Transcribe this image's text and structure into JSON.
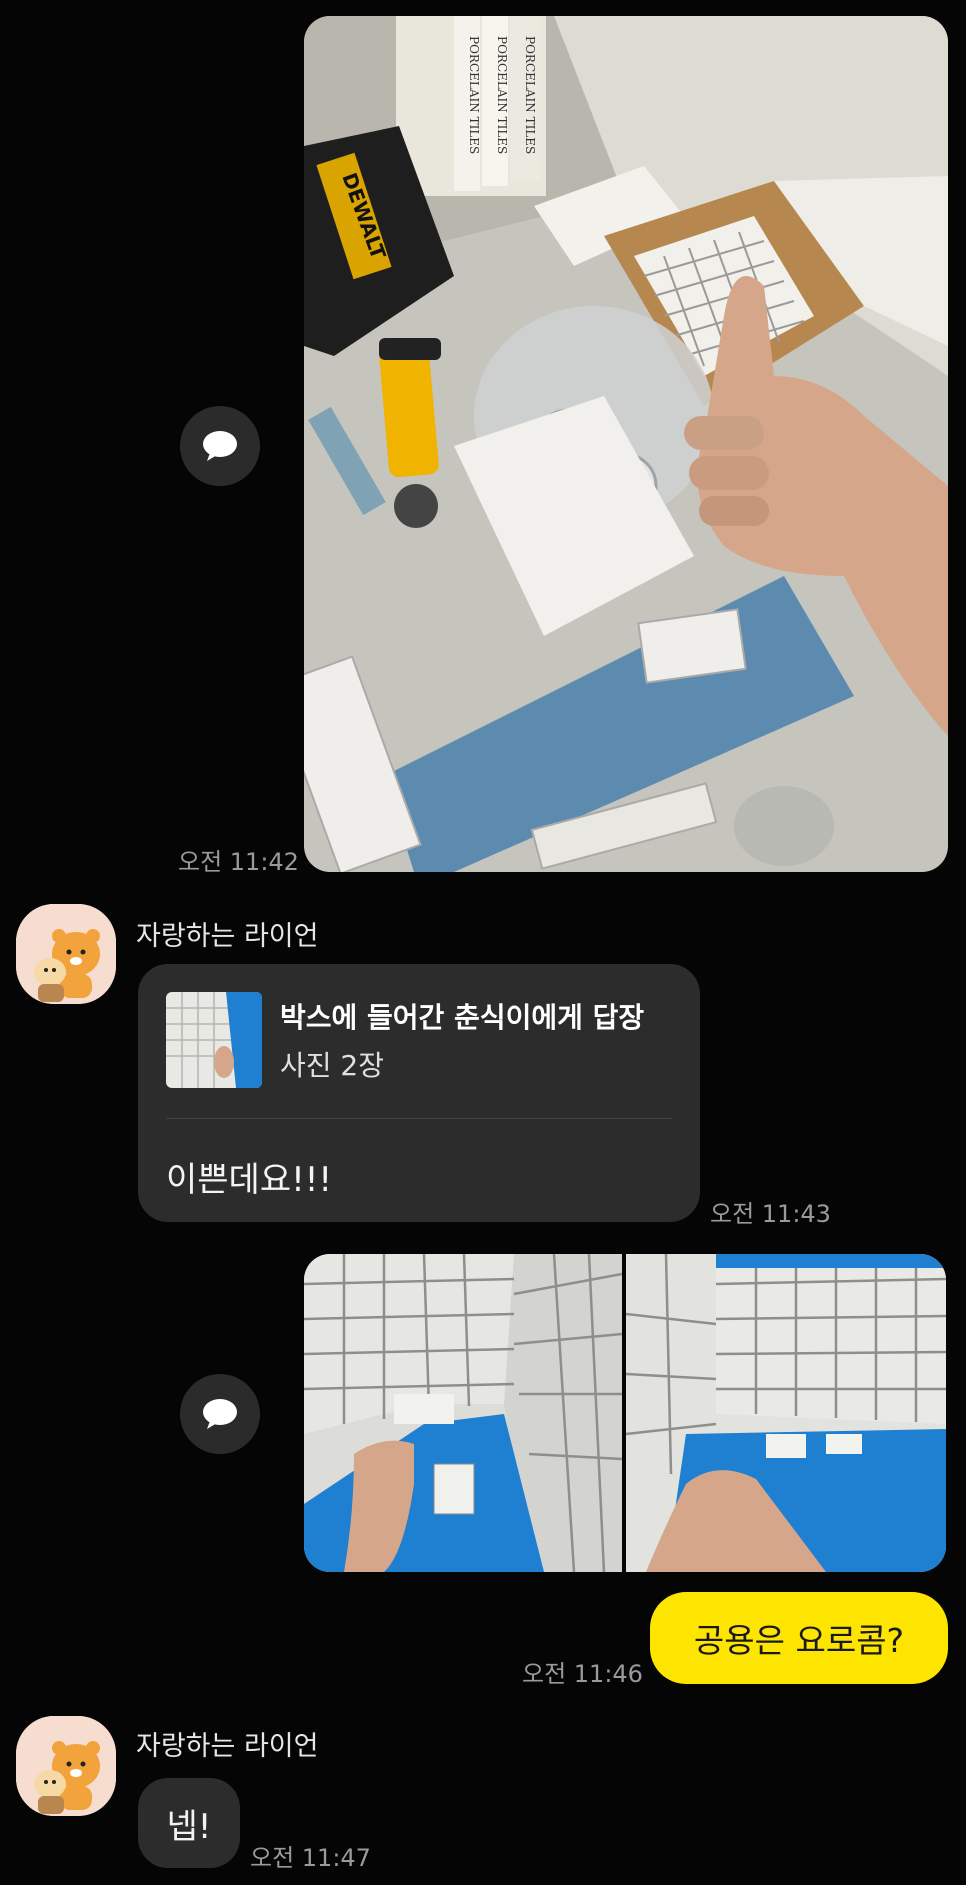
{
  "messages": {
    "m1": {
      "time": "오전 11:42"
    },
    "m2": {
      "sender": "자랑하는 라이언",
      "reply_title": "박스에 들어간 춘식이에게 답장",
      "reply_subtitle": "사진 2장",
      "text": "이쁜데요!!!",
      "time": "오전 11:43"
    },
    "m3": {},
    "m4": {
      "text": "공용은 요로콤?",
      "time": "오전 11:46"
    },
    "m5": {
      "sender": "자랑하는 라이언",
      "text": "넵!",
      "time": "오전 11:47"
    }
  },
  "photo_labels": {
    "tile_box_1": "PORCELAIN TILES",
    "tile_box_2": "PORCELAIN TILES",
    "tile_box_3": "PORCELAIN TILES",
    "tool_brand": "DEWALT"
  },
  "colors": {
    "background": "#050505",
    "bubble_gray": "#2c2c2c",
    "bubble_yellow": "#fee500",
    "avatar_bg": "#f7ddd0"
  },
  "icons": {
    "share": "speech-bubble-icon",
    "avatar": "ryan-character-icon"
  }
}
